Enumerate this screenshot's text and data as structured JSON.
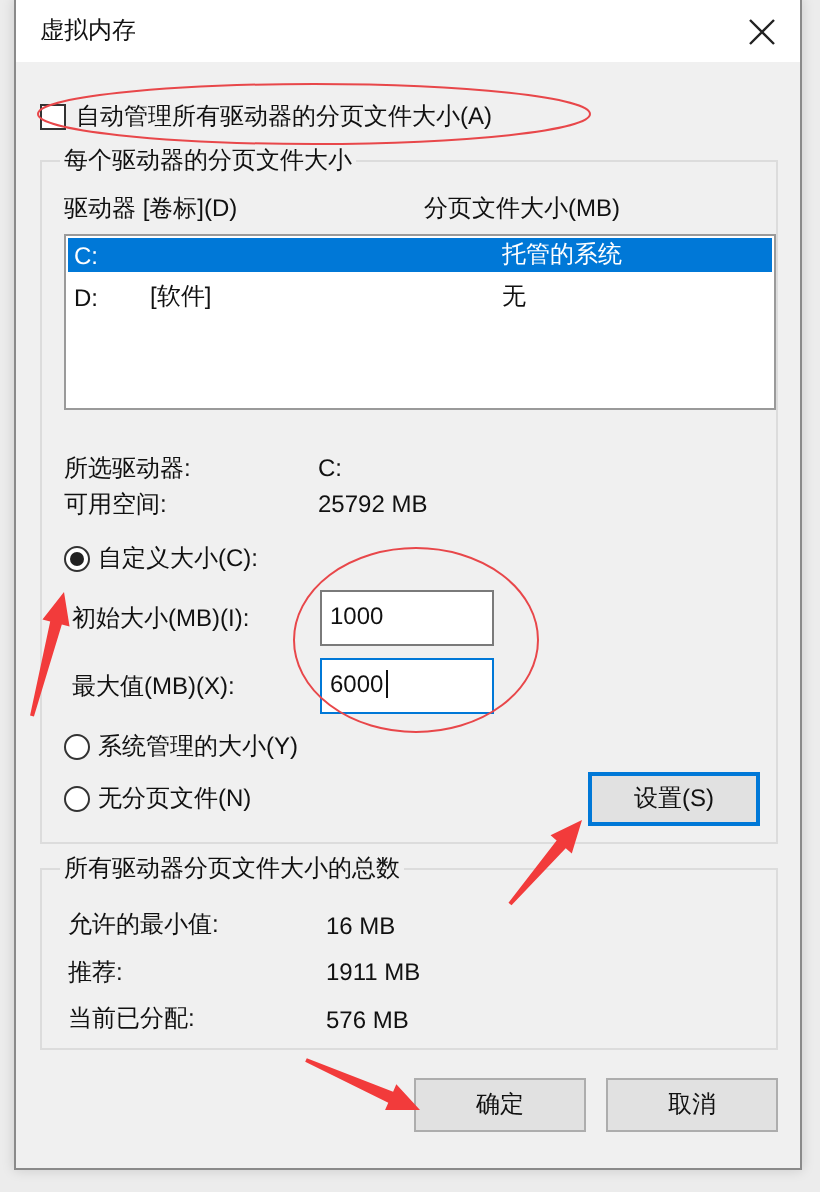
{
  "window": {
    "title": "虚拟内存"
  },
  "auto_manage": {
    "label": "自动管理所有驱动器的分页文件大小(A)",
    "checked": false
  },
  "drives_group": {
    "title": "每个驱动器的分页文件大小",
    "columns": [
      "驱动器 [卷标](D)",
      "分页文件大小(MB)"
    ],
    "rows": [
      {
        "drive": "C:",
        "size": "托管的系统",
        "selected": true
      },
      {
        "drive": "D:",
        "label": "[软件]",
        "size": "无",
        "selected": false
      }
    ],
    "info": [
      {
        "label": "所选驱动器:",
        "value": "C:"
      },
      {
        "label": "可用空间:",
        "value": "25792 MB"
      }
    ],
    "options": [
      {
        "label": "自定义大小(C):",
        "selected": true,
        "fields": [
          {
            "label": "初始大小(MB)(I):",
            "value": "1000",
            "focused": false
          },
          {
            "label": "最大值(MB)(X):",
            "value": "6000",
            "focused": true
          }
        ]
      },
      {
        "label": "系统管理的大小(Y)",
        "selected": false
      },
      {
        "label": "无分页文件(N)",
        "selected": false
      }
    ],
    "set_button": {
      "label": "设置(S)",
      "default": true
    }
  },
  "totals_group": {
    "title": "所有驱动器分页文件大小的总数",
    "rows": [
      {
        "label": "允许的最小值:",
        "value": "16 MB"
      },
      {
        "label": "推荐:",
        "value": "1911 MB"
      },
      {
        "label": "当前已分配:",
        "value": "576 MB"
      }
    ]
  },
  "buttons": [
    "确定",
    "取消"
  ],
  "annotations": [
    {
      "kind": "ellipse"
    },
    {
      "kind": "ellipse"
    },
    {
      "kind": "arrow"
    },
    {
      "kind": "arrow"
    },
    {
      "kind": "arrow"
    }
  ]
}
